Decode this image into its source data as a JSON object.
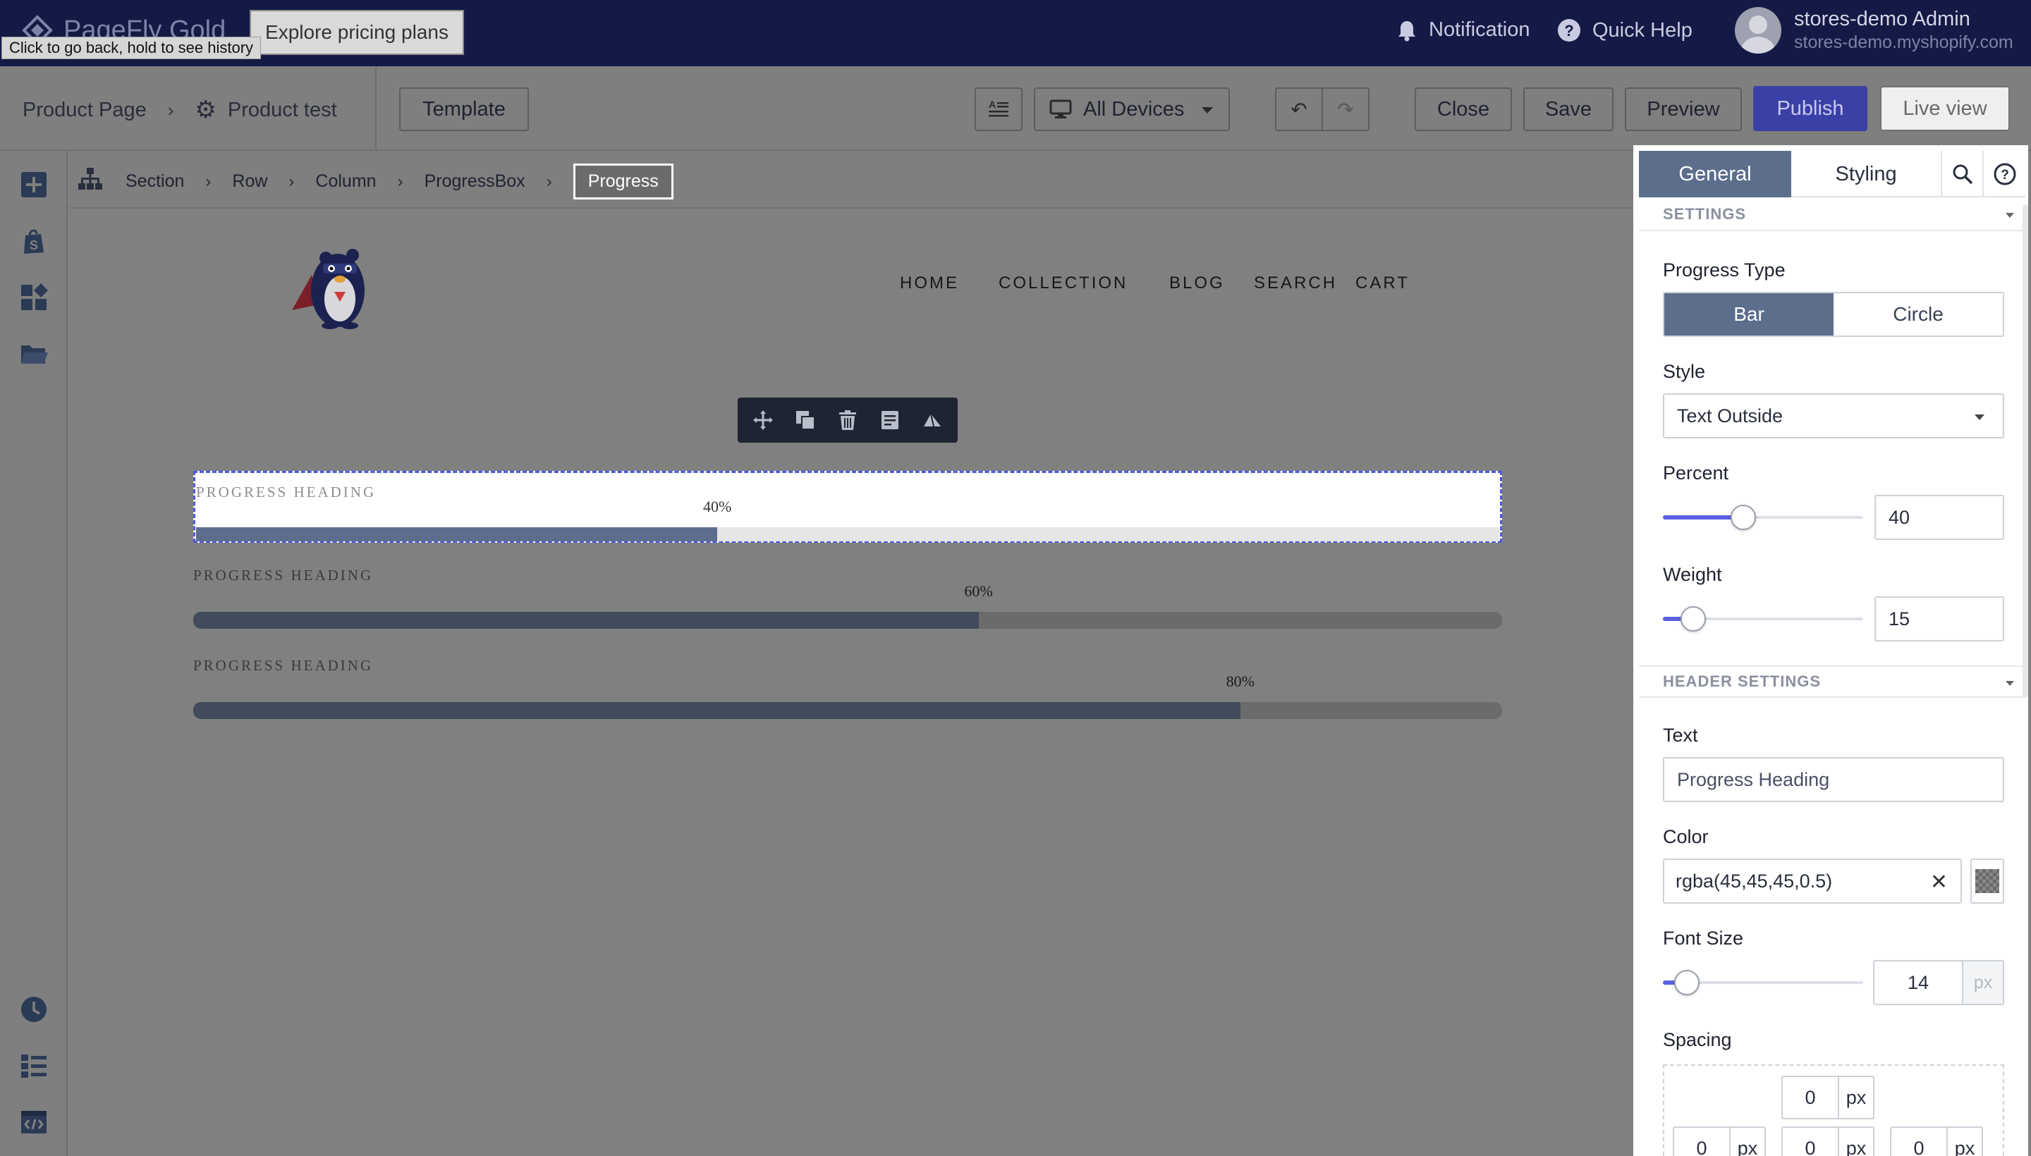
{
  "topbar": {
    "logo_text": "PageFly Gold",
    "explore_label": "Explore pricing plans",
    "tooltip": "Click to go back, hold to see history",
    "notification_label": "Notification",
    "help_label": "Quick Help",
    "user_name": "stores-demo Admin",
    "user_store": "stores-demo.myshopify.com"
  },
  "toolbar": {
    "page_type": "Product Page",
    "page_name": "Product test",
    "template_label": "Template",
    "device_label": "All Devices",
    "close_label": "Close",
    "save_label": "Save",
    "preview_label": "Preview",
    "publish_label": "Publish",
    "live_view_label": "Live view"
  },
  "breadcrumb": {
    "items": [
      "Section",
      "Row",
      "Column",
      "ProgressBox"
    ],
    "active": "Progress"
  },
  "shop_nav": [
    "HOME",
    "COLLECTION",
    "BLOG",
    "SEARCH",
    "CART"
  ],
  "progress_bars": [
    {
      "heading": "PROGRESS HEADING",
      "percent": 40,
      "label": "40%"
    },
    {
      "heading": "PROGRESS HEADING",
      "percent": 60,
      "label": "60%"
    },
    {
      "heading": "PROGRESS HEADING",
      "percent": 80,
      "label": "80%"
    }
  ],
  "panel": {
    "tab_general": "General",
    "tab_styling": "Styling",
    "settings_title": "SETTINGS",
    "progress_type_label": "Progress Type",
    "type_bar": "Bar",
    "type_circle": "Circle",
    "style_label": "Style",
    "style_value": "Text Outside",
    "percent_label": "Percent",
    "percent_value": "40",
    "percent_slider": 0.4,
    "weight_label": "Weight",
    "weight_value": "15",
    "weight_slider": 0.15,
    "header_settings_title": "HEADER SETTINGS",
    "text_label": "Text",
    "text_value": "Progress Heading",
    "color_label": "Color",
    "color_value": "rgba(45,45,45,0.5)",
    "font_size_label": "Font Size",
    "font_size_value": "14",
    "font_size_unit": "px",
    "font_size_slider": 0.12,
    "spacing_label": "Spacing",
    "spacing_top": "0",
    "spacing_left": "0",
    "spacing_mid": "0",
    "spacing_right": "0",
    "unit": "px"
  },
  "colors": {
    "topbar_bg": "#141a45",
    "accent": "#5a5fe0",
    "publish_bg": "#3b40a6",
    "tab_active": "#5c6e8c",
    "bar_fill_selected": "#5c6e8c",
    "bar_fill": "#414b5b"
  }
}
